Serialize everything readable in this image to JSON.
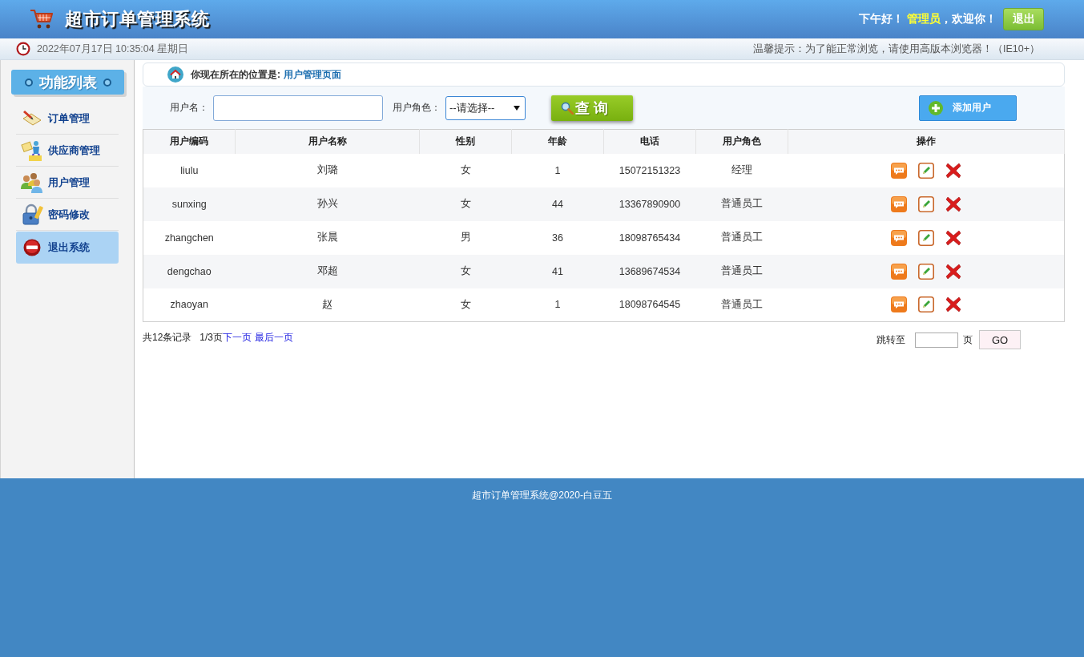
{
  "header": {
    "title": "超市订单管理系统",
    "greeting": "下午好！",
    "user_name": "管理员",
    "welcome": "，欢迎你！",
    "logout_button": "退出"
  },
  "info_bar": {
    "datetime": "2022年07月17日 10:35:04 星期日",
    "notice": "温馨提示：为了能正常浏览，请使用高版本浏览器！（IE10+）"
  },
  "sidebar": {
    "title": "功能列表",
    "items": [
      {
        "label": "订单管理",
        "selected": false
      },
      {
        "label": "供应商管理",
        "selected": false
      },
      {
        "label": "用户管理",
        "selected": false
      },
      {
        "label": "密码修改",
        "selected": false
      },
      {
        "label": "退出系统",
        "selected": true
      }
    ]
  },
  "breadcrumb": {
    "label": "你现在所在的位置是:",
    "current": "用户管理页面"
  },
  "search": {
    "username_label": "用户名：",
    "role_label": "用户角色：",
    "role_select": "--请选择--",
    "query_button": "查 询",
    "add_button": "添加用户"
  },
  "table": {
    "columns": [
      "用户编码",
      "用户名称",
      "性别",
      "年龄",
      "电话",
      "用户角色",
      "操作"
    ],
    "rows": [
      {
        "code": "liulu",
        "name": "刘璐",
        "gender": "女",
        "age": "1",
        "phone": "15072151323",
        "role": "经理"
      },
      {
        "code": "sunxing",
        "name": "孙兴",
        "gender": "女",
        "age": "44",
        "phone": "13367890900",
        "role": "普通员工"
      },
      {
        "code": "zhangchen",
        "name": "张晨",
        "gender": "男",
        "age": "36",
        "phone": "18098765434",
        "role": "普通员工"
      },
      {
        "code": "dengchao",
        "name": "邓超",
        "gender": "女",
        "age": "41",
        "phone": "13689674534",
        "role": "普通员工"
      },
      {
        "code": "zhaoyan",
        "name": "赵",
        "gender": "女",
        "age": "1",
        "phone": "18098764545",
        "role": "普通员工"
      }
    ]
  },
  "pagination": {
    "total": "共12条记录",
    "page": "1/3页",
    "next_link": "下一页",
    "last_link": "最后一页",
    "jump_label": "跳转至",
    "page_unit": "页",
    "go_button": "GO"
  },
  "footer": "超市订单管理系统@2020-白豆五"
}
